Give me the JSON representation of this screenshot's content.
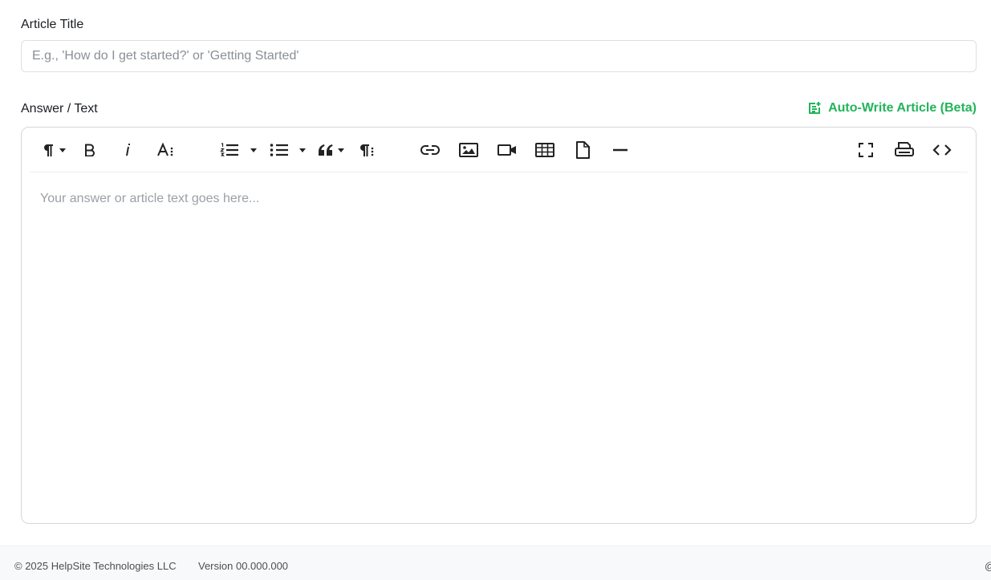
{
  "form": {
    "title_label": "Article Title",
    "title_placeholder": "E.g., 'How do I get started?' or 'Getting Started'",
    "title_value": "",
    "answer_label": "Answer / Text",
    "auto_write_label": "Auto-Write Article (Beta)",
    "editor_placeholder": "Your answer or article text goes here..."
  },
  "toolbar": {
    "buttons": [
      "paragraph-format",
      "bold",
      "italic",
      "font-size",
      "ordered-list",
      "unordered-list",
      "quote",
      "paragraph-style",
      "insert-link",
      "insert-image",
      "insert-video",
      "insert-table",
      "insert-file",
      "horizontal-line",
      "fullscreen",
      "print",
      "code-view"
    ]
  },
  "footer": {
    "copyright": "© 2025 HelpSite Technologies LLC",
    "version": "Version 00.000.000",
    "right_fragment": "@"
  },
  "colors": {
    "accent": "#22b45a",
    "border": "#d4d7db",
    "placeholder": "#9ba0a6"
  }
}
